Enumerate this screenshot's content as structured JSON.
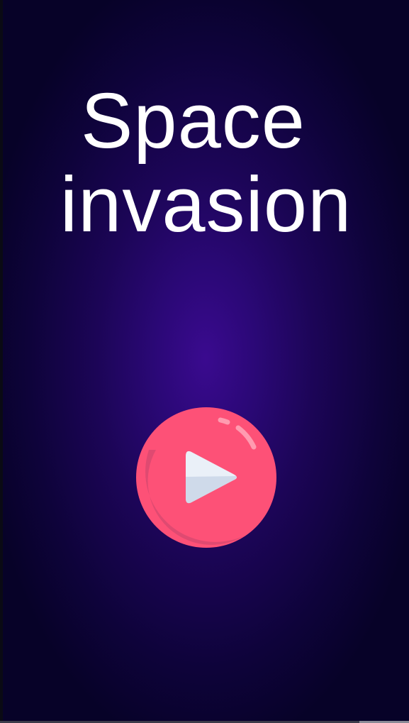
{
  "game": {
    "title_line1": "Space",
    "title_line2": "invasion"
  },
  "play_button": {
    "icon": "play-icon"
  },
  "colors": {
    "background_center": "#3a0a8f",
    "background_edge": "#070228",
    "title_text": "#ffffff",
    "button_primary": "#fd5177",
    "button_shadow": "#df4a71",
    "play_triangle": "#eaf0f8"
  }
}
